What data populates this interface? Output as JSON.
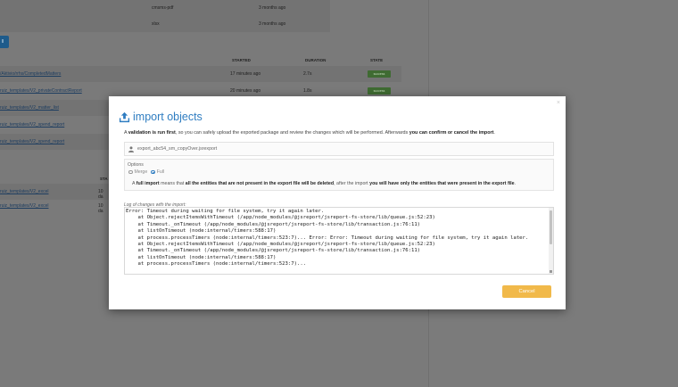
{
  "background": {
    "top_rows": [
      {
        "name": "cmsms-pdf",
        "time": "3 months ago"
      },
      {
        "name": "xlsx",
        "time": "3 months ago"
      }
    ],
    "button_label": "ll",
    "headers": {
      "started": "STARTED",
      "duration": "DURATION",
      "state": "STATE"
    },
    "rows": [
      {
        "path": "/Aktivio/rrhs/CompletedMatters",
        "started": "17 minutes ago",
        "duration": "2.7s",
        "state": "success"
      },
      {
        "path": "ruiz_templates/V2_privateContractReport",
        "started": "20 minutes ago",
        "duration": "1.8s",
        "state": "success"
      },
      {
        "path": "ruiz_templates/V2_matter_list",
        "started": "",
        "duration": "",
        "state": ""
      },
      {
        "path": "ruiz_templates/V2_spend_report",
        "started": "",
        "duration": "",
        "state": ""
      },
      {
        "path": "ruiz_templates/V2_spend_report",
        "started": "",
        "duration": "",
        "state": ""
      }
    ],
    "lower_header": "STA",
    "lower_rows": [
      {
        "path": "ruiz_templates/V2_excel",
        "started": "10 da"
      },
      {
        "path": "ruiz_templates/V2_excel",
        "started": "10 da"
      }
    ]
  },
  "modal": {
    "close": "×",
    "title": "import objects",
    "desc_prefix": "A ",
    "desc_bold1": "validation is run first",
    "desc_mid": ", so you can safely upload the exported package and review the changes which will be performed. Afterwards ",
    "desc_bold2": "you can confirm or cancel the import",
    "desc_end": ".",
    "file_name": "export_abc54_sm_copyOver.jsrexport",
    "options_label": "Options",
    "option_merge": "Merge",
    "option_full": "Full",
    "selected_option": "Full",
    "note_prefix": "A ",
    "note_bold1": "full import",
    "note_mid1": " means that ",
    "note_bold2": "all the entities that are not present in the export file will be deleted",
    "note_mid2": ", after the import ",
    "note_bold3": "you will have only the entities that were present in the export file",
    "note_end": ".",
    "log_label": "Log of changes with the import:",
    "log_text": "Error: Timeout during waiting for file system, try it again later.\n    at Object.rejectItemsWithTimeout (/app/node_modules/@jsreport/jsreport-fs-store/lib/queue.js:52:23)\n    at Timeout._onTimeout (/app/node_modules/@jsreport/jsreport-fs-store/lib/transaction.js:76:11)\n    at listOnTimeout (node:internal/timers:588:17)\n    at process.processTimers (node:internal/timers:523:7)... Error: Error: Timeout during waiting for file system, try it again later.\n    at Object.rejectItemsWithTimeout (/app/node_modules/@jsreport/jsreport-fs-store/lib/queue.js:52:23)\n    at Timeout._onTimeout (/app/node_modules/@jsreport/jsreport-fs-store/lib/transaction.js:76:11)\n    at listOnTimeout (node:internal/timers:588:17)\n    at process.processTimers (node:internal/timers:523:7)...",
    "cancel_label": "Cancel",
    "colors": {
      "accent": "#2f7dc1",
      "cancel": "#f1b94a"
    }
  }
}
